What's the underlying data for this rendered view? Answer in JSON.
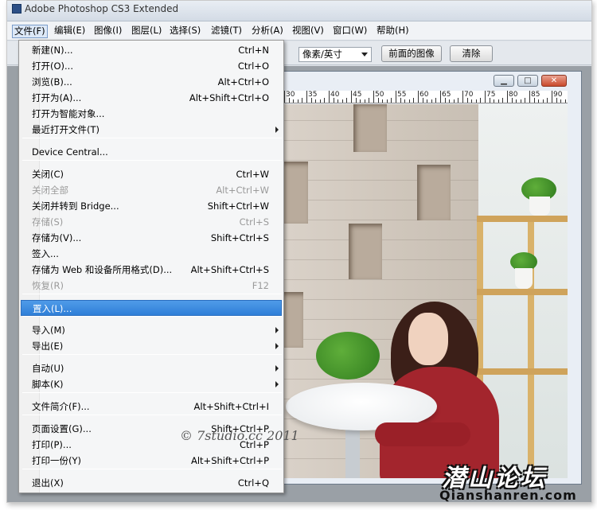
{
  "window": {
    "title": "Adobe Photoshop CS3 Extended"
  },
  "menubar": [
    {
      "label": "文件(F)"
    },
    {
      "label": "编辑(E)"
    },
    {
      "label": "图像(I)"
    },
    {
      "label": "图层(L)"
    },
    {
      "label": "选择(S)"
    },
    {
      "label": "滤镜(T)"
    },
    {
      "label": "分析(A)"
    },
    {
      "label": "视图(V)"
    },
    {
      "label": "窗口(W)"
    },
    {
      "label": "帮助(H)"
    }
  ],
  "options_bar": {
    "units_select": "像素/英寸",
    "front_image_button": "前面的图像",
    "clear_button": "清除"
  },
  "document": {
    "ruler_labels": [
      "30",
      "35",
      "40",
      "45",
      "50",
      "55",
      "60",
      "65",
      "70",
      "75",
      "80",
      "85",
      "90"
    ]
  },
  "file_menu": {
    "items": [
      {
        "label": "新建(N)...",
        "shortcut": "Ctrl+N"
      },
      {
        "label": "打开(O)...",
        "shortcut": "Ctrl+O"
      },
      {
        "label": "浏览(B)...",
        "shortcut": "Alt+Ctrl+O"
      },
      {
        "label": "打开为(A)...",
        "shortcut": "Alt+Shift+Ctrl+O"
      },
      {
        "label": "打开为智能对象...",
        "shortcut": ""
      },
      {
        "label": "最近打开文件(T)",
        "shortcut": ""
      },
      {
        "label": "Device Central...",
        "shortcut": ""
      },
      {
        "label": "关闭(C)",
        "shortcut": "Ctrl+W"
      },
      {
        "label": "关闭全部",
        "shortcut": "Alt+Ctrl+W"
      },
      {
        "label": "关闭并转到 Bridge...",
        "shortcut": "Shift+Ctrl+W"
      },
      {
        "label": "存储(S)",
        "shortcut": "Ctrl+S"
      },
      {
        "label": "存储为(V)...",
        "shortcut": "Shift+Ctrl+S"
      },
      {
        "label": "签入...",
        "shortcut": ""
      },
      {
        "label": "存储为 Web 和设备所用格式(D)...",
        "shortcut": "Alt+Shift+Ctrl+S"
      },
      {
        "label": "恢复(R)",
        "shortcut": "F12"
      },
      {
        "label": "置入(L)...",
        "shortcut": ""
      },
      {
        "label": "导入(M)",
        "shortcut": ""
      },
      {
        "label": "导出(E)",
        "shortcut": ""
      },
      {
        "label": "自动(U)",
        "shortcut": ""
      },
      {
        "label": "脚本(K)",
        "shortcut": ""
      },
      {
        "label": "文件简介(F)...",
        "shortcut": "Alt+Shift+Ctrl+I"
      },
      {
        "label": "页面设置(G)...",
        "shortcut": "Shift+Ctrl+P"
      },
      {
        "label": "打印(P)...",
        "shortcut": "Ctrl+P"
      },
      {
        "label": "打印一份(Y)",
        "shortcut": "Alt+Shift+Ctrl+P"
      },
      {
        "label": "退出(X)",
        "shortcut": "Ctrl+Q"
      }
    ]
  },
  "watermarks": {
    "copyright": "© 7studio.cc 2011",
    "forum_name": "潜山论坛",
    "forum_url": "Qianshanren.com"
  }
}
